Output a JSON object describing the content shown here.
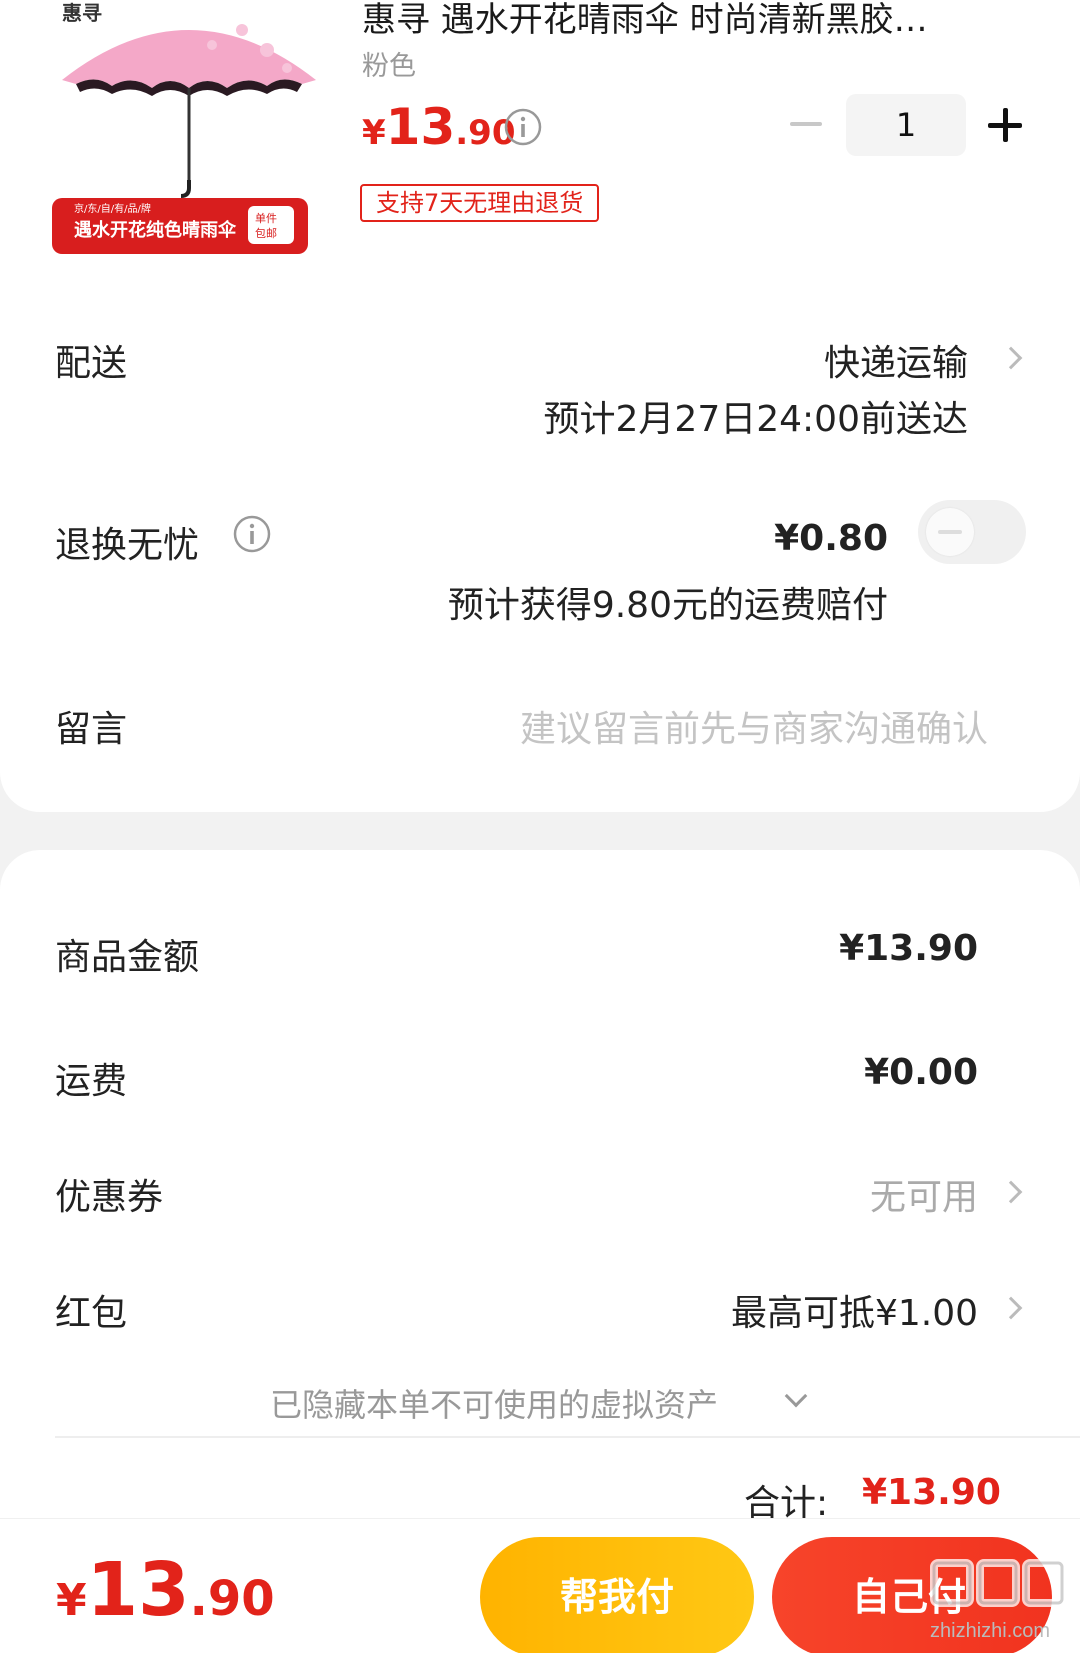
{
  "product": {
    "title": "惠寻 遇水开花晴雨伞 时尚清新黑胶…",
    "variant": "粉色",
    "price_currency": "¥",
    "price_int": "13",
    "price_dec": ".90",
    "quantity": "1",
    "return_tag": "支持7天无理由退货",
    "image_banner_small": "京/东/自/有/品/牌",
    "image_banner_main": "遇水开花纯色晴雨伞",
    "image_badge": "单件包邮",
    "image_logo": "惠寻"
  },
  "delivery": {
    "label": "配送",
    "method": "快递运输",
    "eta": "预计2月27日24:00前送达"
  },
  "return_insurance": {
    "label": "退换无忧",
    "price": "¥0.80",
    "note": "预计获得9.80元的运费赔付",
    "toggle_on": false
  },
  "message": {
    "label": "留言",
    "placeholder": "建议留言前先与商家沟通确认"
  },
  "summary": {
    "goods_label": "商品金额",
    "goods_value": "¥13.90",
    "shipping_label": "运费",
    "shipping_value": "¥0.00",
    "coupon_label": "优惠券",
    "coupon_value": "无可用",
    "redpacket_label": "红包",
    "redpacket_value": "最高可抵¥1.00",
    "hidden_assets": "已隐藏本单不可使用的虚拟资产",
    "total_label": "合计:",
    "total_value": "¥13.90"
  },
  "bottom": {
    "price_currency": "¥",
    "price_int": "13",
    "price_dec": ".90",
    "help_pay": "帮我付",
    "self_pay": "自己付"
  },
  "watermark": "zhizhizhi.com",
  "colors": {
    "accent_red": "#e2231a",
    "help_button": "#ffb300",
    "self_button": "#f1331f"
  }
}
